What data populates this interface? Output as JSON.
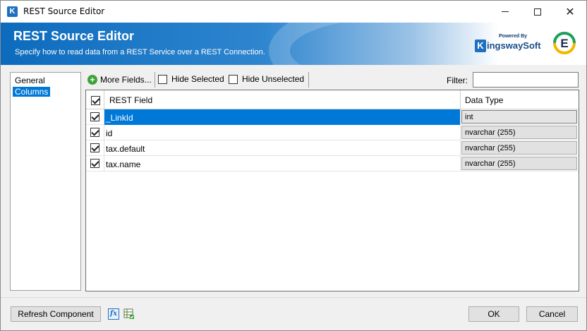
{
  "window": {
    "title": "REST Source Editor",
    "app_icon_letter": "K"
  },
  "banner": {
    "title": "REST Source Editor",
    "subtitle": "Specify how to read data from a REST Service over a REST Connection.",
    "powered_by": "Powered By",
    "brand_k": "K",
    "brand_name": "ingswaySoft",
    "product_letter": "E"
  },
  "nav": {
    "items": [
      {
        "label": "General",
        "selected": false
      },
      {
        "label": "Columns",
        "selected": true
      }
    ]
  },
  "toolbar": {
    "more_fields_label": "More Fields...",
    "hide_selected_label": "Hide Selected",
    "hide_unselected_label": "Hide Unselected",
    "filter_label": "Filter:",
    "filter_value": ""
  },
  "grid": {
    "columns": [
      "REST Field",
      "Data Type"
    ],
    "rows": [
      {
        "checked": true,
        "field": "_LinkId",
        "type": "int",
        "selected": true
      },
      {
        "checked": true,
        "field": "id",
        "type": "nvarchar (255)",
        "selected": false
      },
      {
        "checked": true,
        "field": "tax.default",
        "type": "nvarchar (255)",
        "selected": false
      },
      {
        "checked": true,
        "field": "tax.name",
        "type": "nvarchar (255)",
        "selected": false
      }
    ]
  },
  "buttons": {
    "refresh_label": "Refresh Component",
    "ok_label": "OK",
    "cancel_label": "Cancel"
  },
  "icons": {
    "fx_label": "fx"
  }
}
